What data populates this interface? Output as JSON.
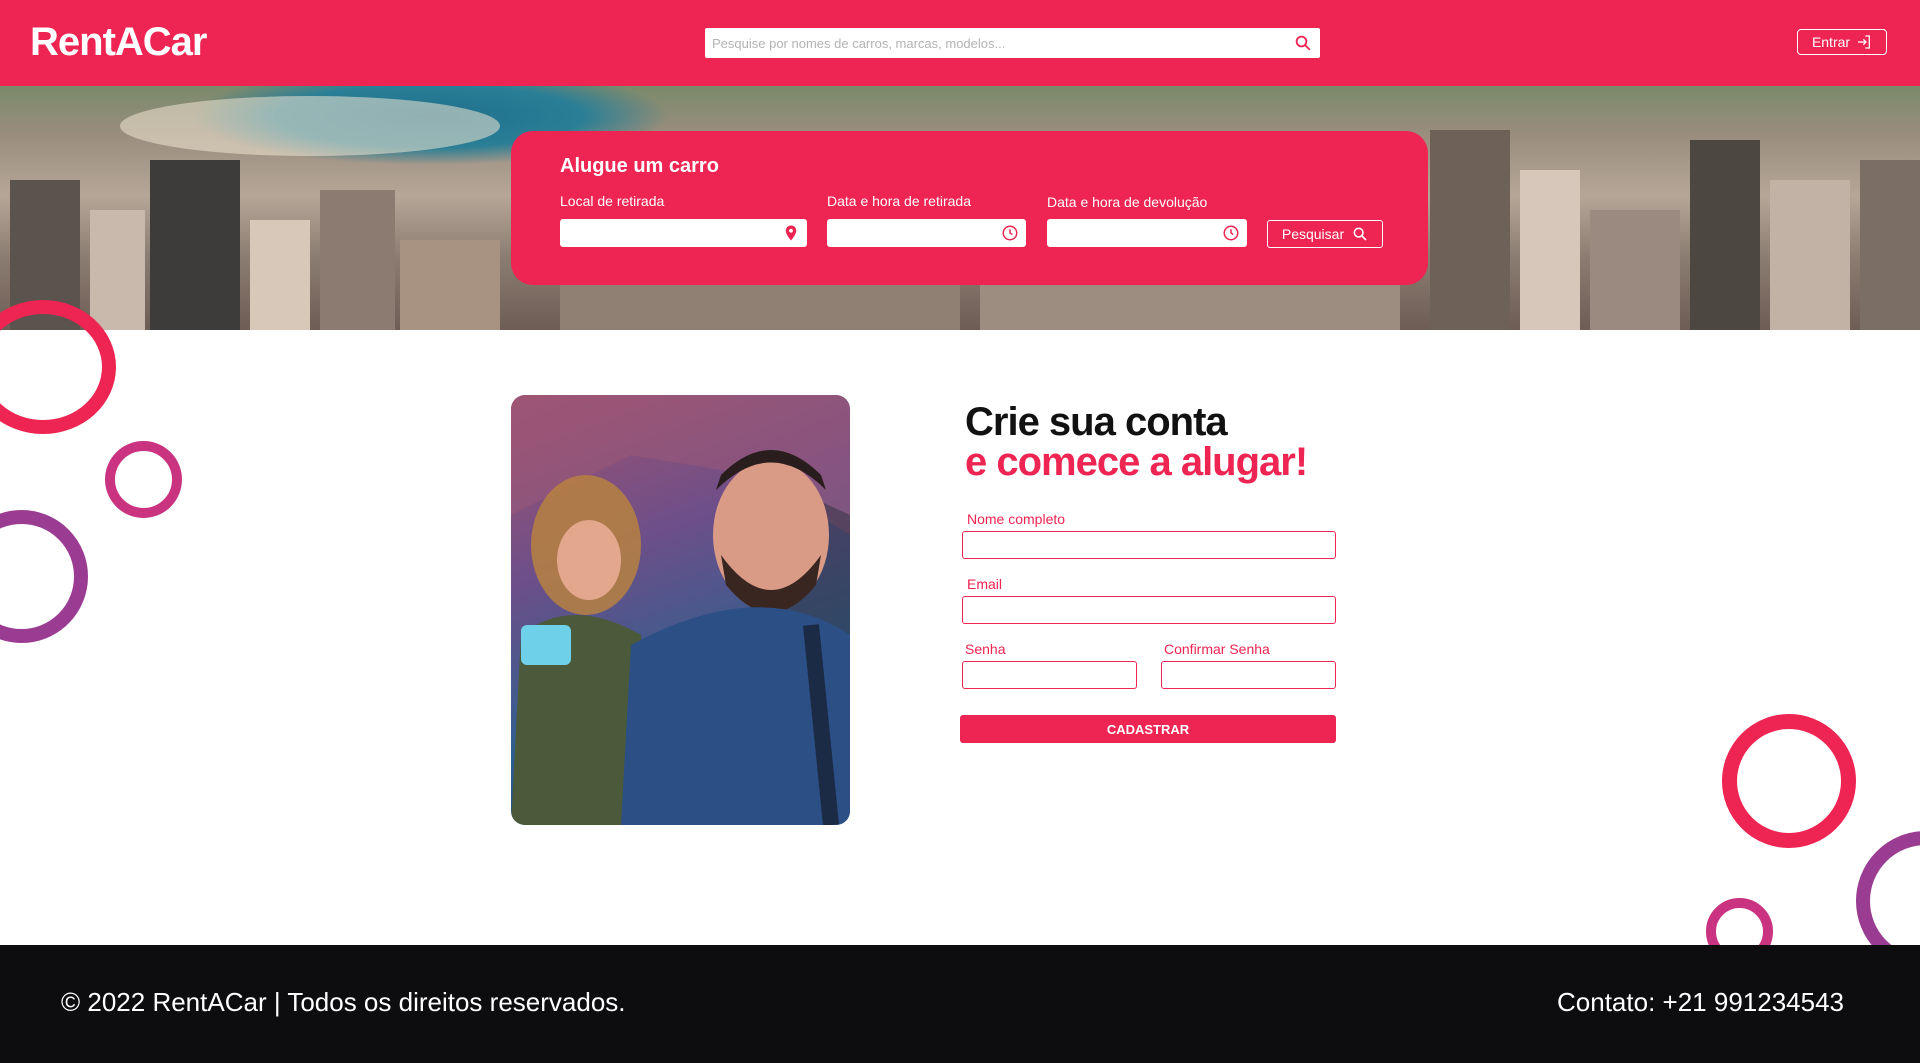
{
  "header": {
    "logo": "RentACar",
    "search_placeholder": "Pesquise por nomes de carros, marcas, modelos...",
    "login_label": "Entrar"
  },
  "rent_form": {
    "title": "Alugue um carro",
    "pickup_location_label": "Local de retirada",
    "pickup_datetime_label": "Data e hora de retirada",
    "return_datetime_label": "Data e hora de devolução",
    "search_label": "Pesquisar"
  },
  "signup": {
    "title_line1": "Crie sua conta",
    "title_line2": "e comece a alugar!",
    "name_label": "Nome completo",
    "email_label": "Email",
    "password_label": "Senha",
    "confirm_password_label": "Confirmar Senha",
    "submit_label": "CADASTRAR"
  },
  "footer": {
    "copyright": "© 2022 RentACar | Todos os direitos reservados.",
    "contact": "Contato:  +21 991234543"
  },
  "colors": {
    "brand": "#ee2452",
    "footer_bg": "#0d0d0f",
    "ring_purple": "#9b3c93",
    "ring_magenta": "#c9337f"
  },
  "icons": {
    "search": "search-icon",
    "login": "login-icon",
    "location": "location-pin-icon",
    "clock": "clock-icon"
  }
}
